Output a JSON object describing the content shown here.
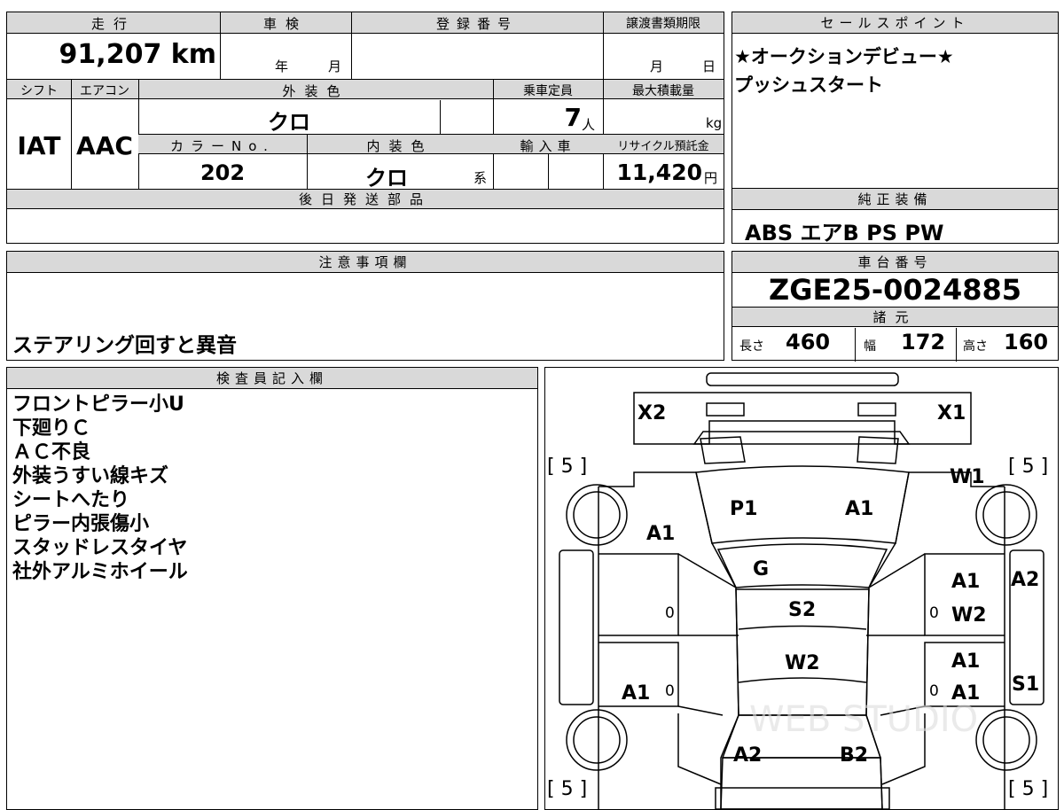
{
  "header": {
    "mileage_label": "走行",
    "mileage_value": "91,207",
    "mileage_unit": "km",
    "inspection_label": "車検",
    "inspection_year_unit": "年",
    "inspection_month_unit": "月",
    "registration_label": "登録番号",
    "transfer_label": "譲渡書類期限",
    "transfer_month_unit": "月",
    "transfer_day_unit": "日",
    "shift_label": "シフト",
    "shift_value": "IAT",
    "ac_label": "エアコン",
    "ac_value": "AAC",
    "exterior_label": "外装色",
    "exterior_value": "クロ",
    "capacity_label": "乗車定員",
    "capacity_value": "7",
    "capacity_unit": "人",
    "load_label": "最大積載量",
    "load_unit": "kg",
    "color_no_label": "カラーNo.",
    "color_no_value": "202",
    "interior_label": "内装色",
    "interior_value": "クロ",
    "interior_unit": "系",
    "import_label": "輸入車",
    "recycle_label": "リサイクル預託金",
    "recycle_value": "11,420",
    "recycle_unit": "円",
    "later_parts_label": "後日発送部品"
  },
  "sales": {
    "label": "セールスポイント",
    "line1": "★オークションデビュー★",
    "line2": "プッシュスタート"
  },
  "equipment": {
    "label": "純正装備",
    "value": "ABS エアB PS PW"
  },
  "caution": {
    "label": "注意事項欄",
    "value": "ステアリング回すと異音"
  },
  "chassis": {
    "label": "車台番号",
    "value": "ZGE25-0024885",
    "spec_label": "諸元",
    "length_label": "長さ",
    "length_value": "460",
    "width_label": "幅",
    "width_value": "172",
    "height_label": "高さ",
    "height_value": "160"
  },
  "inspector": {
    "label": "検査員記入欄",
    "lines": [
      "フロントピラー小U",
      "下廻りＣ",
      "ＡＣ不良",
      "外装うすい線キズ",
      "シートへたり",
      "ピラー内張傷小",
      "スタッドレスタイヤ",
      "社外アルミホイール"
    ]
  },
  "diagram": {
    "codes": {
      "x2": "X2",
      "x1": "X1",
      "w1": "W1",
      "p1": "P1",
      "a1_hood": "A1",
      "a1_front_left": "A1",
      "g": "G",
      "a1_front_right_door": "A1",
      "a2_right": "A2",
      "s2": "S2",
      "w2_right": "W2",
      "w2_roof": "W2",
      "a1_rear_right_door": "A1",
      "a1_rear_right_door_b": "A1",
      "s1": "S1",
      "a1_rear_left": "A1",
      "a2_back": "A2",
      "b2_back": "B2"
    },
    "tyre_labels": [
      "[ 5 ]",
      "[ 5 ]",
      "[ 5 ]",
      "[ 5 ]"
    ],
    "zero_marks": [
      "0",
      "0",
      "0",
      "0"
    ],
    "watermark": "WEB STUDIO"
  }
}
